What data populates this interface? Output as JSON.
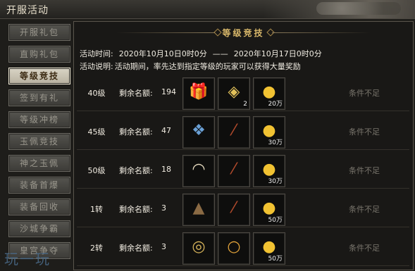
{
  "window": {
    "title": "开服活动"
  },
  "sidebar": {
    "tabs": [
      "开服礼包",
      "直购礼包",
      "等级竞技",
      "签到有礼",
      "等级冲榜",
      "玉佩竞技",
      "神之玉佩",
      "装备首爆",
      "装备回收",
      "沙城争霸",
      "皇宫争夺"
    ],
    "active_index": 2
  },
  "panel": {
    "title": "等级竞技",
    "time_label": "活动时间:",
    "time_start": "2020年10月10日0时0分",
    "time_sep": "——",
    "time_end": "2020年10月17日0时0分",
    "desc_label": "活动说明:",
    "desc_text": "活动期间，率先达到指定等级的玩家可以获得大量奖励"
  },
  "rows": [
    {
      "level": "40级",
      "remain_label": "剩余名额:",
      "remain": "194",
      "status": "条件不足",
      "items": [
        {
          "icon": "gift-box-icon",
          "count": ""
        },
        {
          "icon": "yellow-talisman-icon",
          "count": "2"
        },
        {
          "icon": "gold-ingots-icon",
          "count": "20万"
        }
      ]
    },
    {
      "level": "45级",
      "remain_label": "剩余名额:",
      "remain": "47",
      "status": "条件不足",
      "items": [
        {
          "icon": "blue-gift-box-icon",
          "count": ""
        },
        {
          "icon": "scroll-icon",
          "count": ""
        },
        {
          "icon": "gold-ingots-icon",
          "count": "30万"
        }
      ]
    },
    {
      "level": "50级",
      "remain_label": "剩余名额:",
      "remain": "18",
      "status": "条件不足",
      "items": [
        {
          "icon": "folding-fan-icon",
          "count": ""
        },
        {
          "icon": "scroll-icon",
          "count": ""
        },
        {
          "icon": "gold-ingots-icon",
          "count": "30万"
        }
      ]
    },
    {
      "level": "1转",
      "remain_label": "剩余名额:",
      "remain": "3",
      "status": "条件不足",
      "items": [
        {
          "icon": "straw-hat-icon",
          "count": ""
        },
        {
          "icon": "scroll-icon",
          "count": ""
        },
        {
          "icon": "gold-ingots-icon",
          "count": "50万"
        }
      ]
    },
    {
      "level": "2转",
      "remain_label": "剩余名额:",
      "remain": "3",
      "status": "条件不足",
      "items": [
        {
          "icon": "jade-pendant-icon",
          "count": ""
        },
        {
          "icon": "gold-necklace-icon",
          "count": ""
        },
        {
          "icon": "gold-ingots-icon",
          "count": "50万"
        }
      ]
    }
  ],
  "watermark": {
    "text": "玩一玩"
  }
}
